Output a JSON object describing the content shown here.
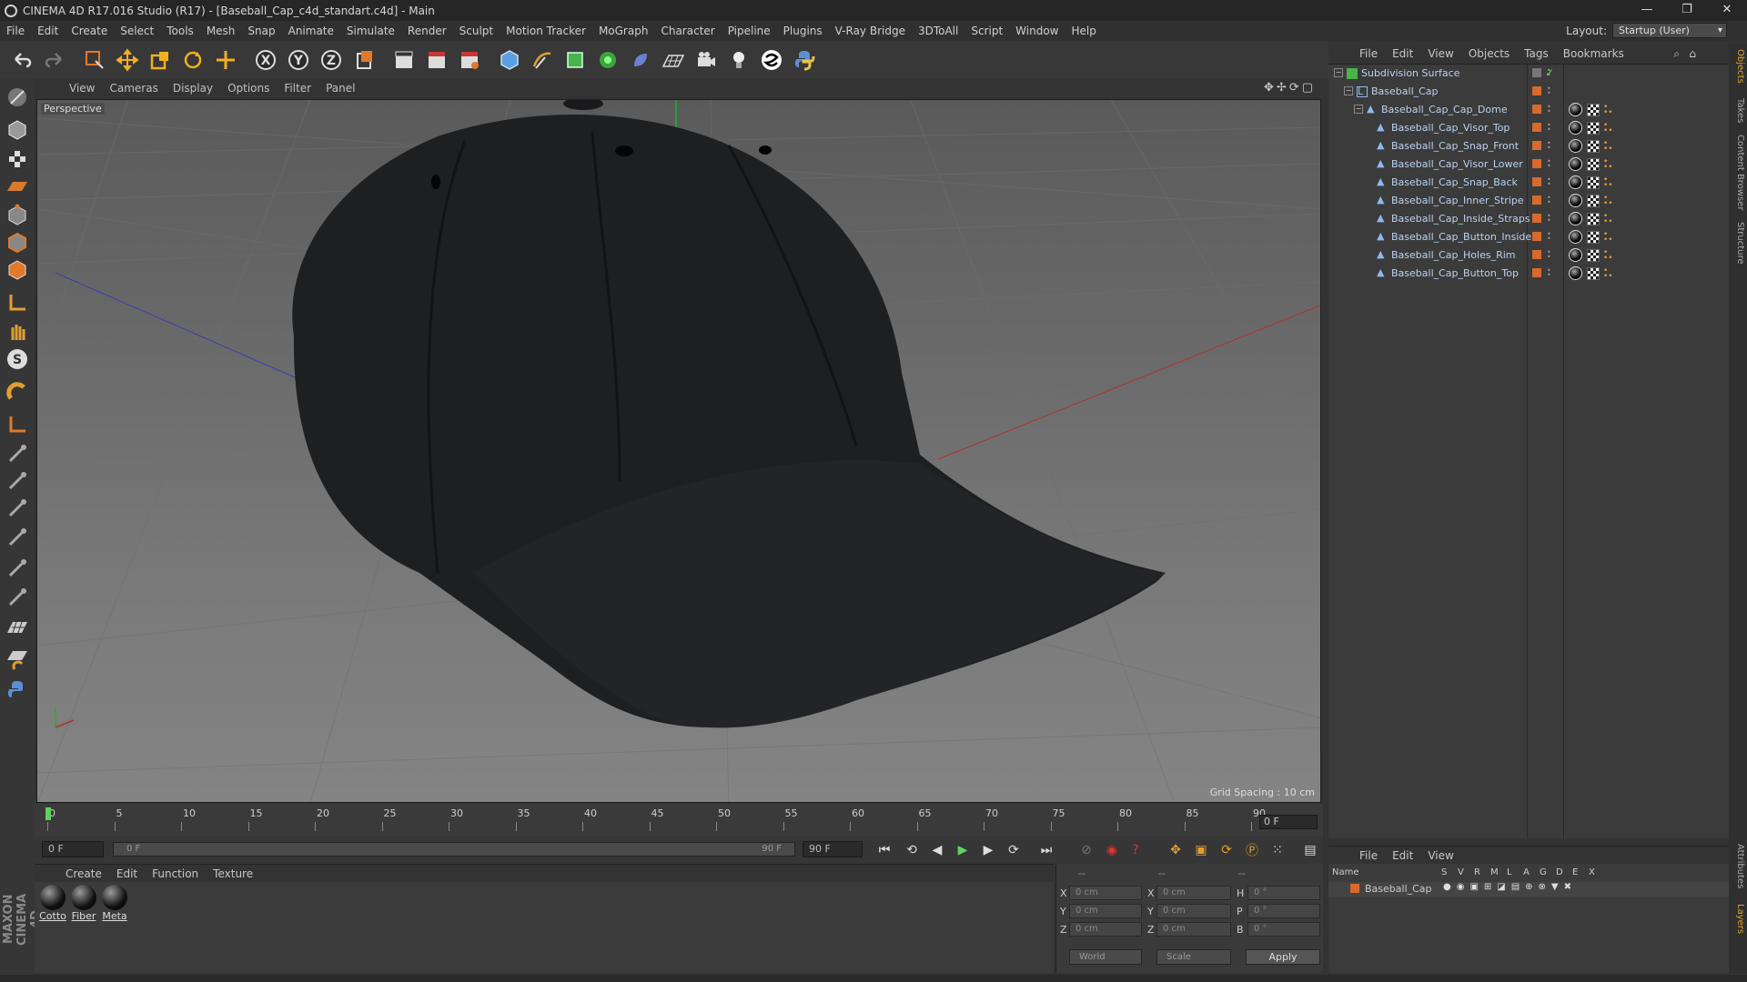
{
  "window": {
    "title": "CINEMA 4D R17.016 Studio (R17) - [Baseball_Cap_c4d_standart.c4d] - Main",
    "controls": [
      "—",
      "❐",
      "✕"
    ]
  },
  "menu": [
    "File",
    "Edit",
    "Create",
    "Select",
    "Tools",
    "Mesh",
    "Snap",
    "Animate",
    "Simulate",
    "Render",
    "Sculpt",
    "Motion Tracker",
    "MoGraph",
    "Character",
    "Pipeline",
    "Plugins",
    "V-Ray Bridge",
    "3DToAll",
    "Script",
    "Window",
    "Help"
  ],
  "layout": {
    "label": "Layout:",
    "value": "Startup (User)"
  },
  "viewport": {
    "menu": [
      "View",
      "Cameras",
      "Display",
      "Options",
      "Filter",
      "Panel"
    ],
    "label": "Perspective",
    "grid_spacing": "Grid Spacing : 10 cm"
  },
  "timeline": {
    "ticks": [
      "0",
      "5",
      "10",
      "15",
      "20",
      "25",
      "30",
      "35",
      "40",
      "45",
      "50",
      "55",
      "60",
      "65",
      "70",
      "75",
      "80",
      "85",
      "90"
    ],
    "current": "0 F"
  },
  "transport": {
    "start": "0 F",
    "slider_left": "0 F",
    "slider_right": "90 F",
    "end": "90 F"
  },
  "material_manager": {
    "menu": [
      "Create",
      "Edit",
      "Function",
      "Texture"
    ],
    "materials": [
      "Cotto",
      "Fiber",
      "Meta"
    ]
  },
  "coordinates": {
    "header": [
      "--",
      "--",
      "--"
    ],
    "rows": [
      {
        "a": "X",
        "av": "0 cm",
        "b": "X",
        "bv": "0 cm",
        "c": "H",
        "cv": "0 °"
      },
      {
        "a": "Y",
        "av": "0 cm",
        "b": "Y",
        "bv": "0 cm",
        "c": "P",
        "cv": "0 °"
      },
      {
        "a": "Z",
        "av": "0 cm",
        "b": "Z",
        "bv": "0 cm",
        "c": "B",
        "cv": "0 °"
      }
    ],
    "world": "World",
    "scale": "Scale",
    "apply": "Apply"
  },
  "object_manager": {
    "menu": [
      "File",
      "Edit",
      "View",
      "Objects",
      "Tags",
      "Bookmarks"
    ],
    "objects": [
      {
        "name": "Subdivision Surface",
        "level": 0
      },
      {
        "name": "Baseball_Cap",
        "level": 1
      },
      {
        "name": "Baseball_Cap_Cap_Dome",
        "level": 2
      },
      {
        "name": "Baseball_Cap_Visor_Top",
        "level": 3
      },
      {
        "name": "Baseball_Cap_Snap_Front",
        "level": 3
      },
      {
        "name": "Baseball_Cap_Visor_Lower",
        "level": 3
      },
      {
        "name": "Baseball_Cap_Snap_Back",
        "level": 3
      },
      {
        "name": "Baseball_Cap_Inner_Stripe",
        "level": 3
      },
      {
        "name": "Baseball_Cap_Inside_Straps",
        "level": 3
      },
      {
        "name": "Baseball_Cap_Button_Inside",
        "level": 3
      },
      {
        "name": "Baseball_Cap_Holes_Rim",
        "level": 3
      },
      {
        "name": "Baseball_Cap_Button_Top",
        "level": 3
      }
    ]
  },
  "layers": {
    "menu": [
      "File",
      "Edit",
      "View"
    ],
    "columns": [
      "Name",
      "S",
      "V",
      "R",
      "M",
      "L",
      "A",
      "G",
      "D",
      "E",
      "X"
    ],
    "row": "Baseball_Cap"
  },
  "side_tabs": [
    "Objects",
    "Takes",
    "Content Browser",
    "Structure",
    "Attributes",
    "Layers"
  ],
  "brand": "MAXON CINEMA 4D",
  "colors": {
    "accent": "#d76a2c",
    "object_text": "#bcd2f0"
  }
}
